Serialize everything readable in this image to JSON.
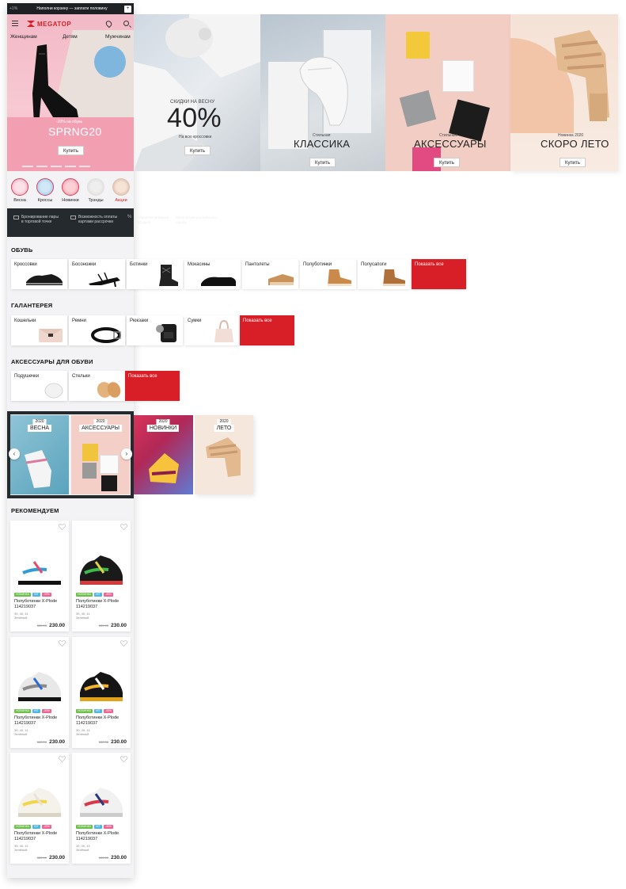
{
  "promo_bar": {
    "left": "+1%",
    "text": "Наполни корзину — заплати половину",
    "right": "+"
  },
  "header": {
    "logo": "MEGATOP",
    "nav": [
      "Женщинам",
      "Детям",
      "Мужчинам"
    ]
  },
  "banners": [
    {
      "sub_top": "-20% на обувь",
      "title": "SPRNG20",
      "button": "Купить"
    },
    {
      "sub_top": "СКИДКИ НА ВЕСНУ",
      "title": "40%",
      "sub_bottom": "На всю кроссовки",
      "button": "Купить"
    },
    {
      "sub_top": "Стильная",
      "title": "КЛАССИКА",
      "button": "Купить"
    },
    {
      "sub_top": "Стильные",
      "title": "АКСЕССУАРЫ",
      "button": "Купить"
    },
    {
      "sub_top": "Новинка 2020",
      "title": "СКОРО ЛЕТО",
      "button": "Купить"
    }
  ],
  "categories": [
    "Весна",
    "Кроссы",
    "Новинки",
    "Трэнды",
    "Акции"
  ],
  "info_bar": [
    "Бронирование пары в торговой точке",
    "Возможность оплаты картами рассрочки"
  ],
  "info_extra": [
    "Гарантия возврата 30 дней",
    "Бесплатная доставка по городу"
  ],
  "sections": {
    "shoes": {
      "title": "ОБУВЬ",
      "items": [
        "Кроссовки",
        "Босоножки",
        "Ботинки",
        "Мокасины",
        "Пантолеты",
        "Полуботинки",
        "Полусапоги"
      ],
      "show_all": "Показать все"
    },
    "haberdashery": {
      "title": "ГАЛАНТЕРЕЯ",
      "items": [
        "Кошельки",
        "Ремни",
        "Рюкзаки",
        "Сумки"
      ],
      "show_all": "Показать все"
    },
    "shoe_accessories": {
      "title": "АКСЕССУАРЫ ДЛЯ ОБУВИ",
      "items": [
        "Подушечки",
        "Стельки"
      ],
      "show_all": "Показать все"
    }
  },
  "carousel": [
    {
      "year": "2020",
      "name": "ВЕСНА"
    },
    {
      "year": "2020",
      "name": "АКСЕССУАРЫ"
    },
    {
      "year": "2020",
      "name": "НОВИНКИ"
    },
    {
      "year": "2020",
      "name": "ЛЕТО"
    }
  ],
  "recommend": {
    "title": "РЕКОМЕНДУЕМ",
    "products": [
      {
        "name": "Полуботинки X-Plode 114219037",
        "sizes": "39, 40, 41",
        "color": "Зелёный",
        "old": "380.00",
        "price": "230.00"
      },
      {
        "name": "Полуботинки X-Plode 114219037",
        "sizes": "39, 40, 41",
        "color": "Зелёный",
        "old": "380.00",
        "price": "230.00"
      },
      {
        "name": "Полуботинки X-Plode 114219037",
        "sizes": "39, 40, 41",
        "color": "Зелёный",
        "old": "380.00",
        "price": "230.00"
      },
      {
        "name": "Полуботинки X-Plode 114219037",
        "sizes": "39, 40, 41",
        "color": "Зелёный",
        "old": "380.00",
        "price": "230.00"
      },
      {
        "name": "Полуботинки X-Plode 114219037",
        "sizes": "39, 40, 41",
        "color": "Зелёный",
        "old": "380.00",
        "price": "230.00"
      },
      {
        "name": "Полуботинки X-Plode 114219037",
        "sizes": "39, 40, 41",
        "color": "Зелёный",
        "old": "380.00",
        "price": "230.00"
      }
    ],
    "badges": [
      "НОВИНКА",
      "HIT",
      "-40%"
    ]
  },
  "colors": {
    "brand_red": "#d81e26",
    "dark": "#252a2f",
    "badge_green": "#6cc04a",
    "badge_blue": "#4fb7e8",
    "badge_pink": "#f06292"
  }
}
